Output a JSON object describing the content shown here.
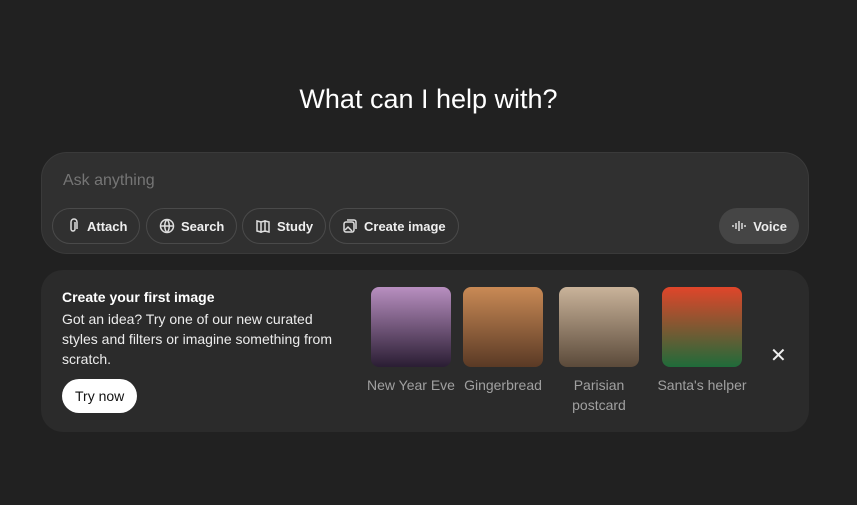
{
  "heading": "What can I help with?",
  "composer": {
    "placeholder": "Ask anything",
    "buttons": [
      {
        "label": "Attach",
        "icon": "paperclip-icon"
      },
      {
        "label": "Search",
        "icon": "globe-icon"
      },
      {
        "label": "Study",
        "icon": "book-icon"
      },
      {
        "label": "Create image",
        "icon": "image-icon"
      }
    ],
    "voice_label": "Voice"
  },
  "promo": {
    "title": "Create your first image",
    "description": "Got an idea? Try one of our new curated styles and filters or imagine something from scratch.",
    "try_label": "Try now",
    "close": "✕",
    "styles": [
      {
        "label": "New Year Eve",
        "colors": [
          "#b88fc0",
          "#2a1d33"
        ]
      },
      {
        "label": "Gingerbread",
        "colors": [
          "#c98a55",
          "#5a3a25"
        ]
      },
      {
        "label": "Parisian postcard",
        "colors": [
          "#c9b39a",
          "#5b4a3a"
        ]
      },
      {
        "label": "Santa's helper",
        "colors": [
          "#e0452a",
          "#1f6b3a"
        ]
      }
    ]
  }
}
